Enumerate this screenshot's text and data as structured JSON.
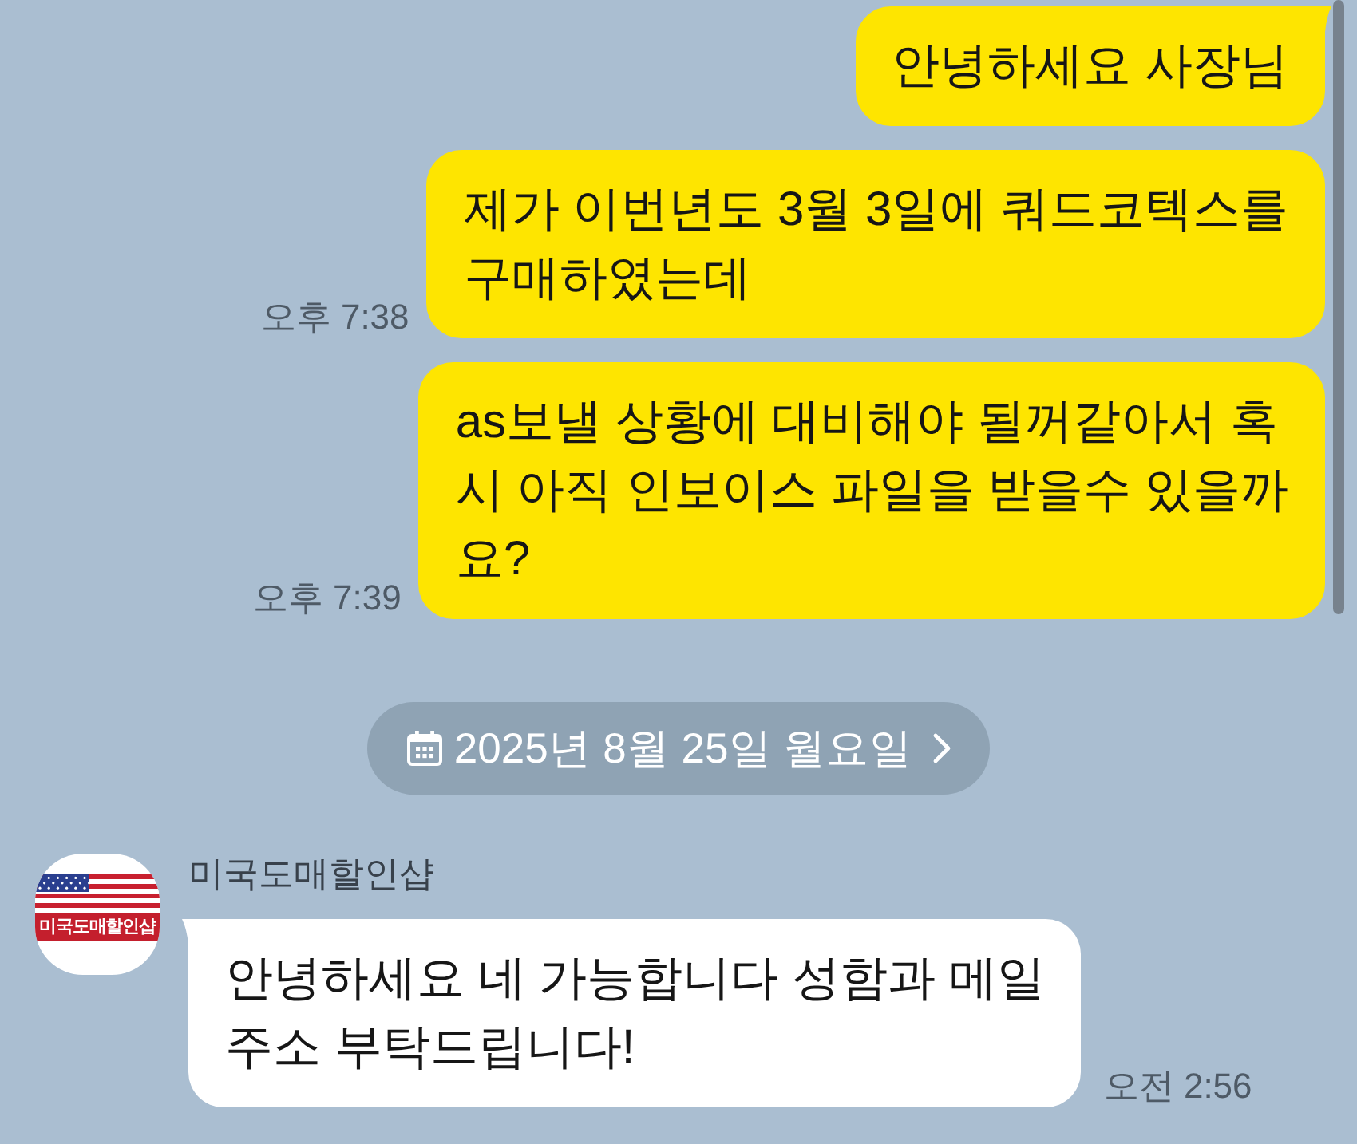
{
  "outgoing": [
    {
      "lines": [
        "안녕하세요 사장님"
      ],
      "tail": true
    },
    {
      "lines": [
        "제가 이번년도 3월 3일에 쿼드코텍스를",
        "구매하였는데"
      ],
      "tail": false,
      "time": "오후 7:38"
    },
    {
      "lines": [
        "as보낼 상황에 대비해야 될꺼같아서 혹",
        "시 아직 인보이스 파일을 받을수 있을까",
        "요?"
      ],
      "tail": false,
      "time": "오후 7:39"
    }
  ],
  "date_divider": {
    "text": "2025년 8월 25일 월요일"
  },
  "incoming": {
    "sender": "미국도매할인샵",
    "avatar_logo_text": "미국도매할인샵",
    "messages": [
      {
        "lines": [
          "안녕하세요 네 가능합니다 성함과 메일",
          "주소 부탁드립니다!"
        ],
        "tail": true,
        "time": "오전 2:56"
      }
    ]
  }
}
